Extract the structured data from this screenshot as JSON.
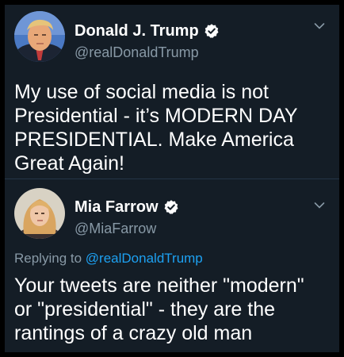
{
  "colors": {
    "background": "#141d26",
    "text": "#ffffff",
    "muted": "#8899a6",
    "link": "#1da1f2",
    "verified": "#ffffff"
  },
  "tweets": [
    {
      "display_name": "Donald J. Trump",
      "handle": "@realDonaldTrump",
      "verified_icon": "verified-badge-icon",
      "menu_icon": "chevron-down-icon",
      "text_lines": [
        "My use of social media is not",
        "Presidential - it’s MODERN DAY",
        "PRESIDENTIAL. Make America",
        "Great Again!"
      ]
    },
    {
      "display_name": "Mia Farrow",
      "handle": "@MiaFarrow",
      "verified_icon": "verified-badge-icon",
      "menu_icon": "chevron-down-icon",
      "reply_prefix": "Replying to",
      "reply_to": "@realDonaldTrump",
      "text_lines": [
        "Your tweets are neither \"modern\"",
        "or \"presidential\" - they are the",
        "rantings of a crazy old man"
      ]
    }
  ]
}
